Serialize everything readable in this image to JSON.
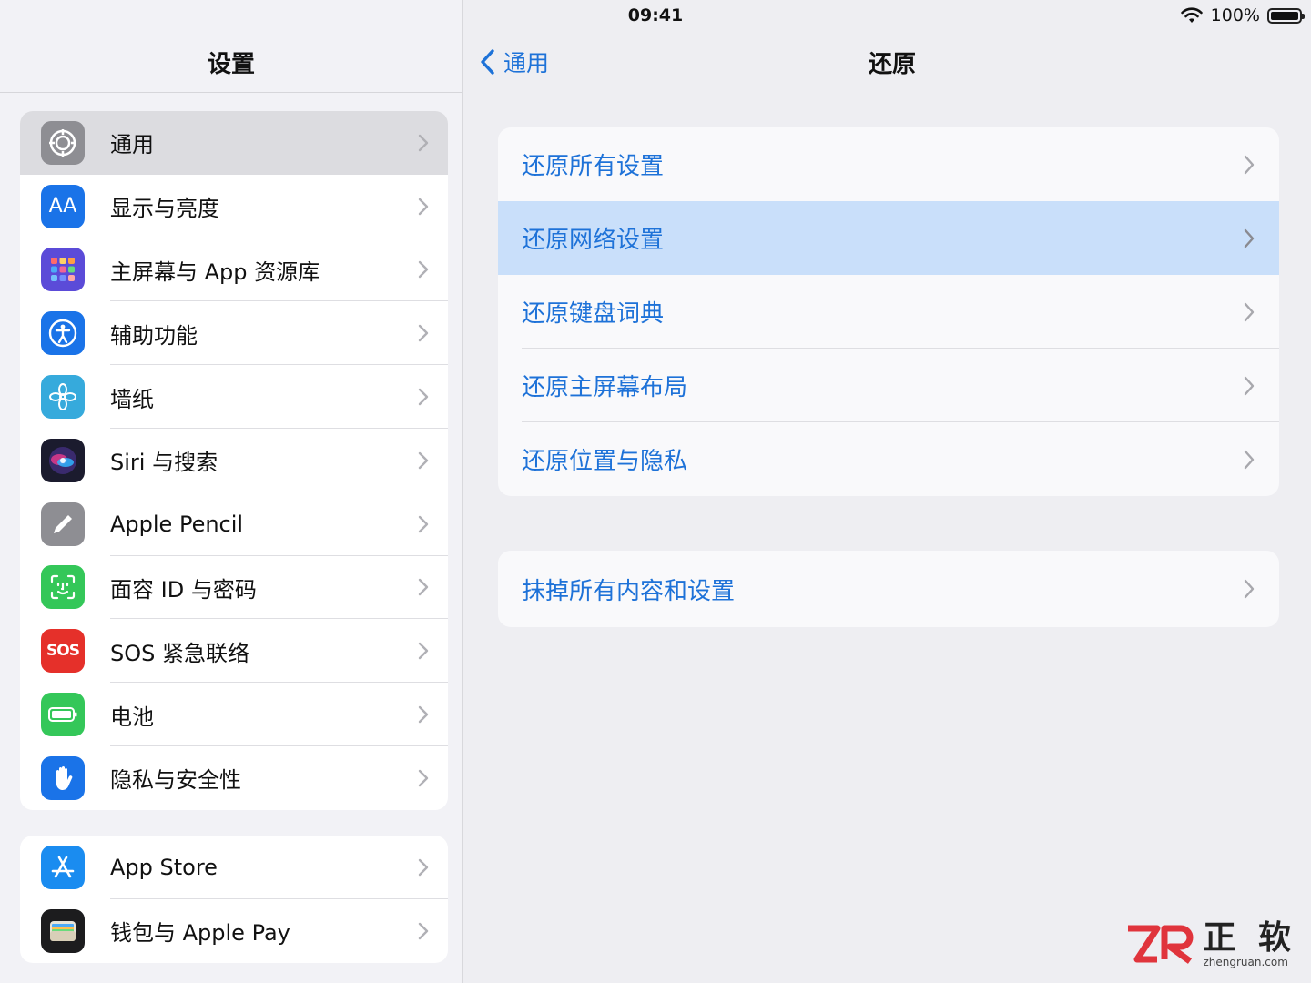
{
  "status": {
    "device": "iPad",
    "time": "09:41",
    "battery": "100%"
  },
  "sidebar": {
    "title": "设置",
    "group1": [
      {
        "label": "通用",
        "icon": "gear-icon",
        "color": "#8e8e93",
        "selected": true
      },
      {
        "label": "显示与亮度",
        "icon": "text-size-icon",
        "color": "#1a73e8"
      },
      {
        "label": "主屏幕与 App 资源库",
        "icon": "home-grid-icon",
        "color": "#5b4bd8"
      },
      {
        "label": "辅助功能",
        "icon": "accessibility-icon",
        "color": "#1a73e8"
      },
      {
        "label": "墙纸",
        "icon": "flower-icon",
        "color": "#36aadc"
      },
      {
        "label": "Siri 与搜索",
        "icon": "siri-icon",
        "color": "#1b1b2e"
      },
      {
        "label": "Apple Pencil",
        "icon": "pencil-icon",
        "color": "#8e8e93"
      },
      {
        "label": "面容 ID 与密码",
        "icon": "face-id-icon",
        "color": "#34c759"
      },
      {
        "label": "SOS 紧急联络",
        "icon": "sos-icon",
        "color": "#e5302a"
      },
      {
        "label": "电池",
        "icon": "battery-icon",
        "color": "#34c759"
      },
      {
        "label": "隐私与安全性",
        "icon": "hand-icon",
        "color": "#1a73e8"
      }
    ],
    "group2": [
      {
        "label": "App Store",
        "icon": "app-store-icon",
        "color": "#1a8cf0"
      },
      {
        "label": "钱包与 Apple Pay",
        "icon": "wallet-icon",
        "color": "#1c1c1e"
      }
    ]
  },
  "main": {
    "back_label": "通用",
    "title": "还原",
    "card1": [
      {
        "label": "还原所有设置"
      },
      {
        "label": "还原网络设置",
        "highlight": true
      },
      {
        "label": "还原键盘词典"
      },
      {
        "label": "还原主屏幕布局"
      },
      {
        "label": "还原位置与隐私"
      }
    ],
    "card2": [
      {
        "label": "抹掉所有内容和设置"
      }
    ]
  },
  "watermark": {
    "logo": "ZR",
    "name": "正 软",
    "site": "zhengruan.com"
  },
  "colors": {
    "accent": "#1e72d8",
    "highlight": "#c9dffa",
    "background": "#eeeef2"
  }
}
